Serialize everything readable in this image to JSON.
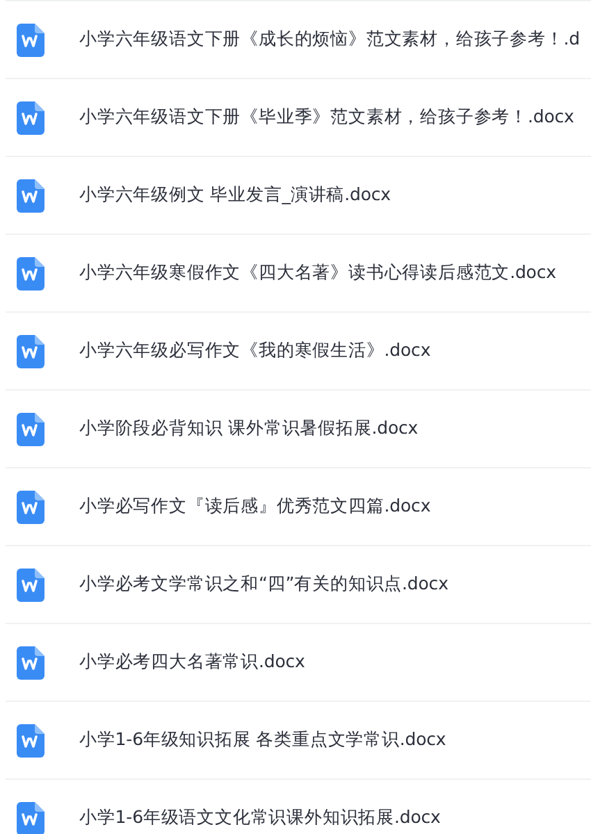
{
  "files": [
    {
      "name": "小学六年级语文下册《成长的烦恼》范文素材，给孩子参考！.d"
    },
    {
      "name": "小学六年级语文下册《毕业季》范文素材，给孩子参考！.docx"
    },
    {
      "name": "小学六年级例文 毕业发言_演讲稿.docx"
    },
    {
      "name": "小学六年级寒假作文《四大名著》读书心得读后感范文.docx"
    },
    {
      "name": "小学六年级必写作文《我的寒假生活》.docx"
    },
    {
      "name": "小学阶段必背知识 课外常识暑假拓展.docx"
    },
    {
      "name": "小学必写作文『读后感』优秀范文四篇.docx"
    },
    {
      "name": "小学必考文学常识之和“四”有关的知识点.docx"
    },
    {
      "name": "小学必考四大名著常识.docx"
    },
    {
      "name": "小学1-6年级知识拓展 各类重点文学常识.docx"
    },
    {
      "name": "小学1-6年级语文文化常识课外知识拓展.docx"
    }
  ]
}
